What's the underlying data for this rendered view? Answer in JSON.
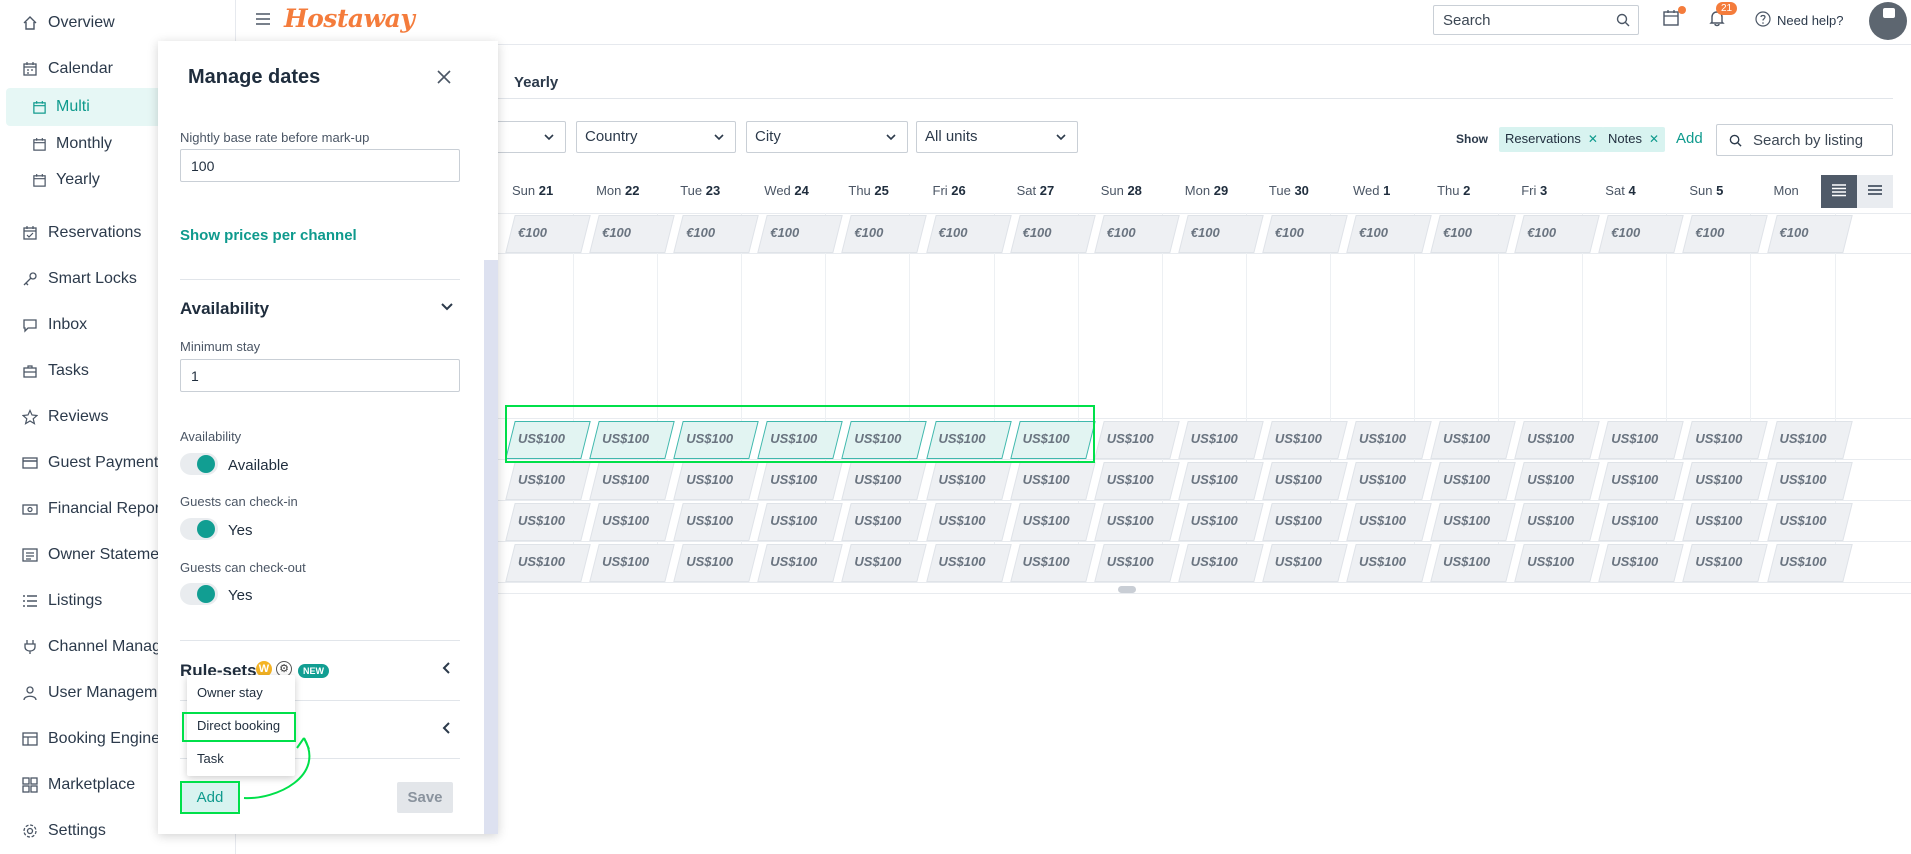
{
  "sidebar": {
    "items": [
      {
        "label": "Overview",
        "icon": "home-icon"
      },
      {
        "label": "Calendar",
        "icon": "calendar-icon"
      },
      {
        "label": "Multi",
        "icon": "calendar-icon"
      },
      {
        "label": "Monthly",
        "icon": "calendar-icon"
      },
      {
        "label": "Yearly",
        "icon": "calendar-icon"
      },
      {
        "label": "Reservations",
        "icon": "calendar-check-icon"
      },
      {
        "label": "Smart Locks",
        "icon": "key-icon"
      },
      {
        "label": "Inbox",
        "icon": "chat-icon"
      },
      {
        "label": "Tasks",
        "icon": "briefcase-icon"
      },
      {
        "label": "Reviews",
        "icon": "star-icon"
      },
      {
        "label": "Guest Payments",
        "icon": "credit-card-icon"
      },
      {
        "label": "Financial Reporti",
        "icon": "money-icon"
      },
      {
        "label": "Owner Statemen",
        "icon": "document-icon"
      },
      {
        "label": "Listings",
        "icon": "list-icon"
      },
      {
        "label": "Channel Manage",
        "icon": "plug-icon"
      },
      {
        "label": "User Managemen",
        "icon": "user-icon"
      },
      {
        "label": "Booking Engine",
        "icon": "window-icon"
      },
      {
        "label": "Marketplace",
        "icon": "grid-icon"
      },
      {
        "label": "Settings",
        "icon": "gear-icon"
      }
    ]
  },
  "header": {
    "logo": "Hostaway",
    "search_placeholder": "Search",
    "notification_count": "21",
    "help": "Need help?"
  },
  "toolbar": {
    "tab_yearly": "Yearly",
    "filters": [
      "",
      "Country",
      "City",
      "All units"
    ],
    "show_label": "Show",
    "chips": [
      "Reservations",
      "Notes"
    ],
    "add_label": "Add",
    "search_listing_placeholder": "Search by listing"
  },
  "calendar": {
    "days": [
      {
        "dow": "Sun",
        "d": "21"
      },
      {
        "dow": "Mon",
        "d": "22"
      },
      {
        "dow": "Tue",
        "d": "23"
      },
      {
        "dow": "Wed",
        "d": "24"
      },
      {
        "dow": "Thu",
        "d": "25"
      },
      {
        "dow": "Fri",
        "d": "26"
      },
      {
        "dow": "Sat",
        "d": "27"
      },
      {
        "dow": "Sun",
        "d": "28"
      },
      {
        "dow": "Mon",
        "d": "29"
      },
      {
        "dow": "Tue",
        "d": "30"
      },
      {
        "dow": "Wed",
        "d": "1"
      },
      {
        "dow": "Thu",
        "d": "2"
      },
      {
        "dow": "Fri",
        "d": "3"
      },
      {
        "dow": "Sat",
        "d": "4"
      },
      {
        "dow": "Sun",
        "d": "5"
      },
      {
        "dow": "Mon",
        "d": ""
      }
    ],
    "top_price": "€100",
    "row_price": "US$100",
    "selected_cells": 7
  },
  "panel": {
    "title": "Manage dates",
    "nightly_label": "Nightly base rate before mark-up",
    "nightly_value": "100",
    "show_prices": "Show prices per channel",
    "availability_section": "Availability",
    "min_stay_label": "Minimum stay",
    "min_stay_value": "1",
    "availability_label": "Availability",
    "availability_value": "Available",
    "checkin_label": "Guests can check-in",
    "checkin_value": "Yes",
    "checkout_label": "Guests can check-out",
    "checkout_value": "Yes",
    "rulesets_label": "Rule-sets",
    "new_badge": "NEW",
    "w_badge": "W",
    "dropdown": [
      "Owner stay",
      "Direct booking",
      "Task"
    ],
    "add_button": "Add",
    "save_button": "Save"
  },
  "colors": {
    "accent": "#0e9a8d",
    "brand": "#f47c3c",
    "highlight": "#00e04a"
  }
}
